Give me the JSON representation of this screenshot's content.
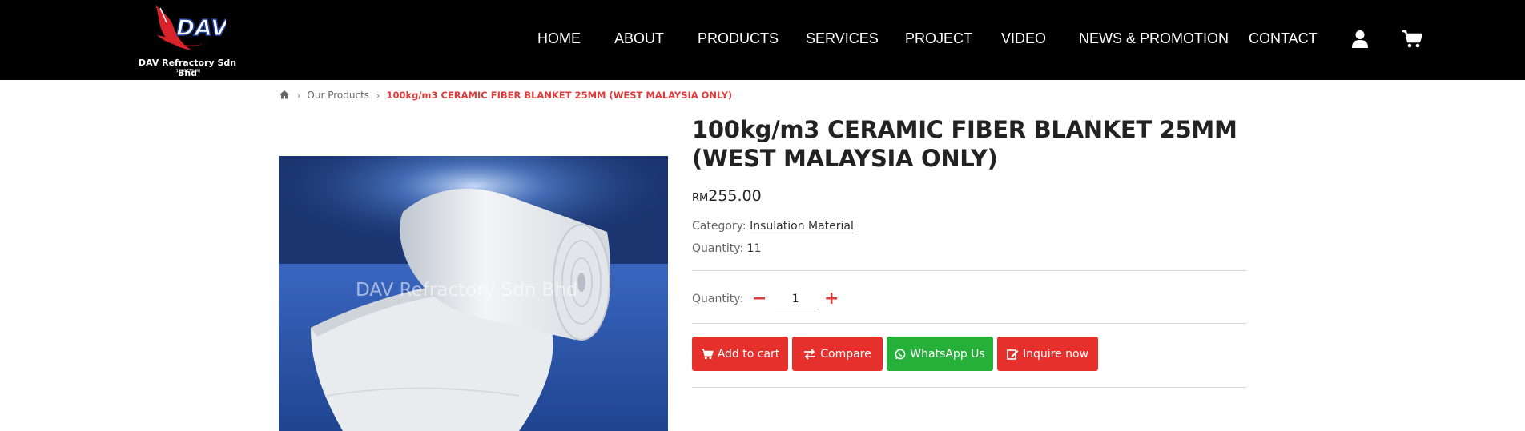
{
  "brand": {
    "logo_text": "DAV",
    "name": "DAV Refractory Sdn Bhd",
    "registration": "(1006779-W)"
  },
  "nav": {
    "items": [
      "HOME",
      "ABOUT",
      "PRODUCTS",
      "SERVICES",
      "PROJECT",
      "VIDEO",
      "NEWS & PROMOTION",
      "CONTACT"
    ],
    "account_icon": "user-icon",
    "cart_icon": "cart-icon"
  },
  "breadcrumb": {
    "home_icon": "home-icon",
    "parent": "Our Products",
    "current": "100kg/m3 CERAMIC FIBER BLANKET 25MM (WEST MALAYSIA ONLY)"
  },
  "product": {
    "title": "100kg/m3 CERAMIC FIBER BLANKET 25MM (WEST MALAYSIA ONLY)",
    "currency": "RM",
    "price": "255.00",
    "category_label": "Category:",
    "category": "Insulation Material",
    "stock_label": "Quantity:",
    "stock": "11",
    "image_watermark": "DAV Refractory Sdn Bhd"
  },
  "quantity": {
    "label": "Quantity:",
    "value": "1",
    "decrement_icon": "minus-icon",
    "increment_icon": "plus-icon"
  },
  "actions": {
    "add_to_cart": "Add to cart",
    "compare": "Compare",
    "whatsapp": "WhatsApp Us",
    "inquire": "Inquire now"
  },
  "colors": {
    "header_bg": "#000000",
    "accent_red": "#e6302c",
    "whatsapp_green": "#25b03a"
  }
}
